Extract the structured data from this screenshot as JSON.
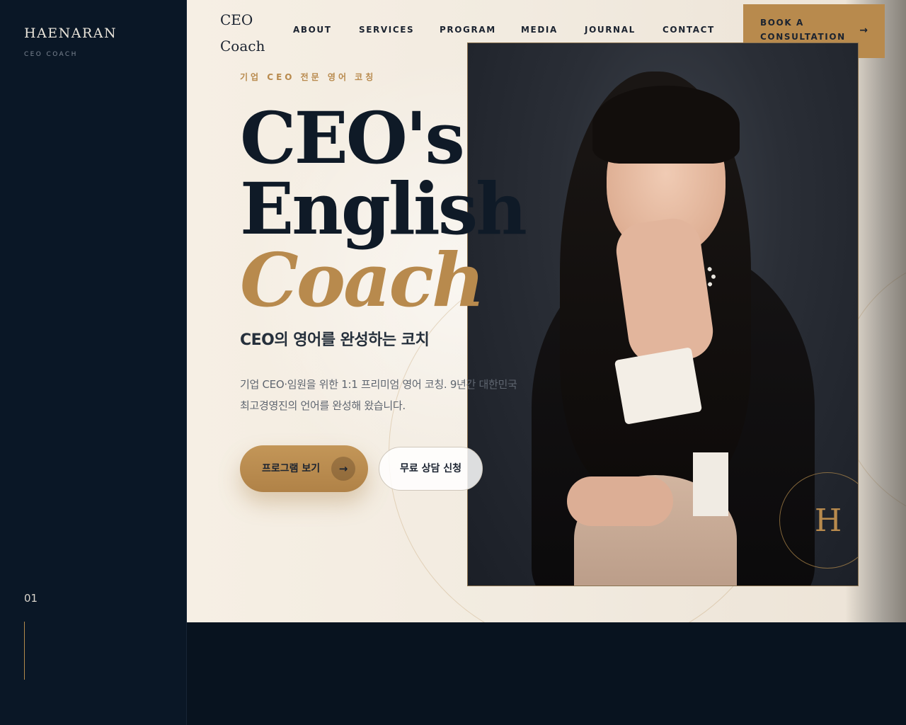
{
  "sidebar": {
    "brand": "HAENARAN",
    "brand_sub": "CEO COACH",
    "slide_number": "01"
  },
  "header": {
    "logo_line1": "CEO",
    "logo_line2": "Coach",
    "nav": [
      "ABOUT",
      "SERVICES",
      "PROGRAM",
      "MEDIA",
      "JOURNAL",
      "CONTACT"
    ],
    "cta_line1": "BOOK A",
    "cta_line2": "CONSULTATION",
    "cta_arrow": "→"
  },
  "hero": {
    "kicker": "기업 CEO 전문 영어 코칭",
    "title_line1": "CEO's",
    "title_line2": "English",
    "title_line3": "Coach",
    "subtitle": "CEO의 영어를 완성하는 코치",
    "description_line1": "기업 CEO·임원을 위한 1:1 프리미엄 영어 코칭. 9년간 대한민국",
    "description_line2": "최고경영진의 언어를 완성해 왔습니다.",
    "primary_button": "프로그램 보기",
    "primary_button_icon": "→",
    "secondary_button": "무료 상담 신청",
    "badge_letter": "H"
  },
  "colors": {
    "navy": "#0a1726",
    "gold": "#b88a4d",
    "cream": "#f6efe4"
  }
}
